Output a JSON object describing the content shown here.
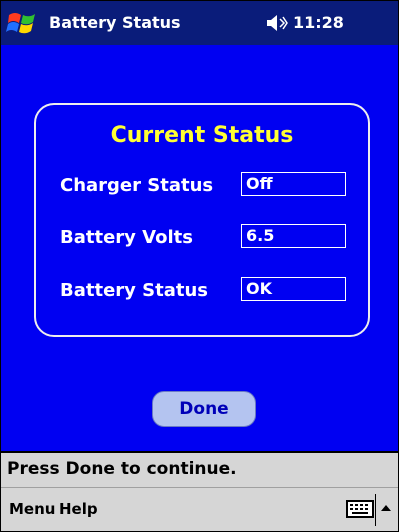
{
  "titlebar": {
    "title": "Battery Status",
    "time": "11:28",
    "icons": {
      "start": "windows-flag-icon",
      "volume": "speaker-icon"
    }
  },
  "panel": {
    "title": "Current Status",
    "rows": [
      {
        "label": "Charger Status",
        "value": "Off"
      },
      {
        "label": "Battery Volts",
        "value": "6.5"
      },
      {
        "label": "Battery Status",
        "value": "OK"
      }
    ]
  },
  "done_button": "Done",
  "status_message": "Press Done to continue.",
  "menubar": {
    "items": [
      "Menu",
      "Help"
    ],
    "icons": {
      "keyboard": "keyboard-icon",
      "input_toggle": "up-arrow-icon"
    }
  },
  "colors": {
    "titlebar_bg": "#0a1c7a",
    "content_bg": "#0000f2",
    "panel_title": "#ffff33",
    "button_bg": "#b4c4f0",
    "bar_bg": "#d6d6d6"
  }
}
